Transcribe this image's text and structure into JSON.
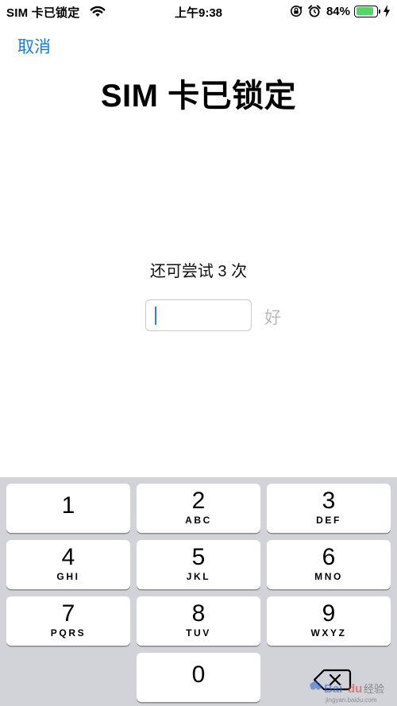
{
  "status_bar": {
    "carrier": "SIM 卡已锁定",
    "time": "上午9:38",
    "battery_percent": "84%",
    "battery_level": 0.84,
    "icons": [
      "wifi-icon",
      "rotation-lock-icon",
      "alarm-icon",
      "battery-icon",
      "charging-bolt-icon"
    ]
  },
  "nav": {
    "cancel_label": "取消",
    "title": "SIM 卡已锁定"
  },
  "pin_entry": {
    "attempts_text": "还可尝试 3 次",
    "value": "",
    "ok_label": "好"
  },
  "keypad": {
    "keys": [
      {
        "digit": "1",
        "letters": ""
      },
      {
        "digit": "2",
        "letters": "ABC"
      },
      {
        "digit": "3",
        "letters": "DEF"
      },
      {
        "digit": "4",
        "letters": "GHI"
      },
      {
        "digit": "5",
        "letters": "JKL"
      },
      {
        "digit": "6",
        "letters": "MNO"
      },
      {
        "digit": "7",
        "letters": "PQRS"
      },
      {
        "digit": "8",
        "letters": "TUV"
      },
      {
        "digit": "9",
        "letters": "WXYZ"
      },
      {
        "digit": "0",
        "letters": ""
      }
    ],
    "delete_icon": "delete-backspace-icon"
  },
  "watermark": {
    "text": "Baidu 经验",
    "subtext": "jingyan.baidu.com"
  },
  "colors": {
    "accent": "#1a7ae8",
    "disabled": "#b9b9bd",
    "keyboard_bg": "#d1d3d9",
    "battery_green": "#4cd964"
  }
}
